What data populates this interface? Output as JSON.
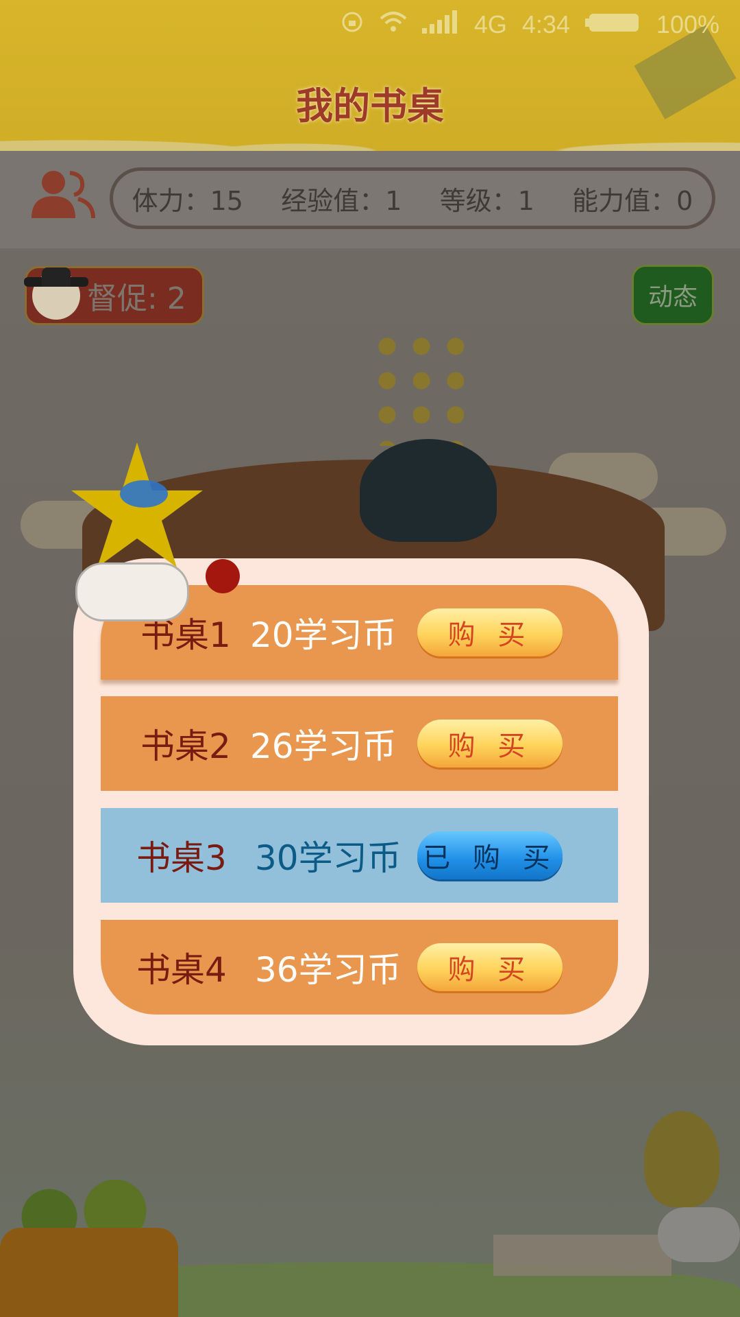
{
  "status_bar": {
    "network": "4G",
    "time": "4:34",
    "battery": "100%",
    "icons": [
      "rotation-lock-icon",
      "wifi-icon",
      "signal-icon",
      "battery-icon"
    ]
  },
  "header": {
    "title": "我的书桌"
  },
  "stats": [
    {
      "label": "体力：15"
    },
    {
      "label": "经验值：1"
    },
    {
      "label": "等级：1"
    },
    {
      "label": "能力值：0"
    }
  ],
  "supervise": {
    "label": "督促: 2"
  },
  "dynamic_button": {
    "label": "动态"
  },
  "desks": [
    {
      "name": "书桌1",
      "price": "20学习币",
      "button": "购 买",
      "state": "buy"
    },
    {
      "name": "书桌2",
      "price": "26学习币",
      "button": "购 买",
      "state": "buy"
    },
    {
      "name": "书桌3",
      "price": "30学习币",
      "button": "已 购 买",
      "state": "bought"
    },
    {
      "name": "书桌4",
      "price": "36学习币",
      "button": "购 买",
      "state": "buy"
    }
  ],
  "colors": {
    "header_bg": "#d8b52a",
    "row_orange": "#e9964f",
    "row_blue": "#92c0db",
    "modal_bg": "#fde7dc",
    "title_red": "#9e3b28"
  }
}
